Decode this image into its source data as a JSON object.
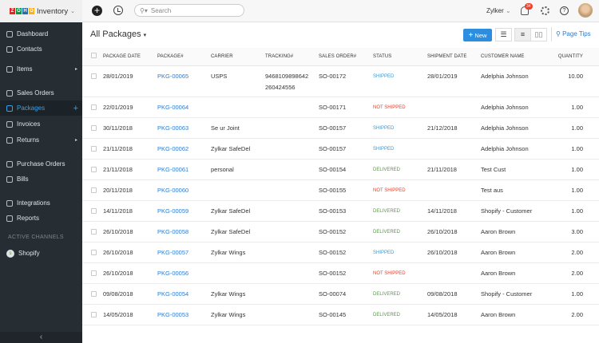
{
  "app": {
    "logo_letters": [
      "Z",
      "O",
      "H",
      "O"
    ],
    "name": "Inventory",
    "search_placeholder": "Search",
    "org": "Zylker",
    "notification_count": "34"
  },
  "sidebar": {
    "items": [
      {
        "label": "Dashboard",
        "icon": "home-icon"
      },
      {
        "label": "Contacts",
        "icon": "user-icon"
      },
      {
        "label": "Items",
        "icon": "basket-icon",
        "arrow": true
      },
      {
        "label": "Sales Orders",
        "icon": "cart-icon"
      },
      {
        "label": "Packages",
        "icon": "package-icon",
        "active": true
      },
      {
        "label": "Invoices",
        "icon": "invoice-icon"
      },
      {
        "label": "Returns",
        "icon": "returns-icon",
        "arrow": true
      },
      {
        "label": "Purchase Orders",
        "icon": "bag-icon"
      },
      {
        "label": "Bills",
        "icon": "bill-icon"
      },
      {
        "label": "Integrations",
        "icon": "integrations-icon"
      },
      {
        "label": "Reports",
        "icon": "reports-icon"
      }
    ],
    "channels_heading": "ACTIVE CHANNELS",
    "channel": "Shopify"
  },
  "main": {
    "title": "All Packages",
    "new_label": "New",
    "page_tips": "Page Tips"
  },
  "table": {
    "headers": [
      "PACKAGE DATE",
      "PACKAGE#",
      "CARRIER",
      "TRACKING#",
      "SALES ORDER#",
      "STATUS",
      "SHIPMENT DATE",
      "CUSTOMER NAME",
      "QUANTITY"
    ],
    "rows": [
      [
        "28/01/2019",
        "PKG-00065",
        "USPS",
        "9468109898642 260424556",
        "SO-00172",
        "SHIPPED",
        "28/01/2019",
        "Adelphia Johnson",
        "10.00"
      ],
      [
        "22/01/2019",
        "PKG-00064",
        "",
        "",
        "SO-00171",
        "NOT SHIPPED",
        "",
        "Adelphia Johnson",
        "1.00"
      ],
      [
        "30/11/2018",
        "PKG-00063",
        "Se ur Joint",
        "",
        "SO-00157",
        "SHIPPED",
        "21/12/2018",
        "Adelphia Johnson",
        "1.00"
      ],
      [
        "21/11/2018",
        "PKG-00062",
        "Zylkar SafeDel",
        "",
        "SO-00157",
        "SHIPPED",
        "",
        "Adelphia Johnson",
        "1.00"
      ],
      [
        "21/11/2018",
        "PKG-00061",
        "personal",
        "",
        "SO-00154",
        "DELIVERED",
        "21/11/2018",
        "Test Cust",
        "1.00"
      ],
      [
        "20/11/2018",
        "PKG-00060",
        "",
        "",
        "SO-00155",
        "NOT SHIPPED",
        "",
        "Test aus",
        "1.00"
      ],
      [
        "14/11/2018",
        "PKG-00059",
        "Zylkar SafeDel",
        "",
        "SO-00153",
        "DELIVERED",
        "14/11/2018",
        "Shopify - Customer",
        "1.00"
      ],
      [
        "26/10/2018",
        "PKG-00058",
        "Zylkar SafeDel",
        "",
        "SO-00152",
        "DELIVERED",
        "26/10/2018",
        "Aaron Brown",
        "3.00"
      ],
      [
        "26/10/2018",
        "PKG-00057",
        "Zylkar Wings",
        "",
        "SO-00152",
        "SHIPPED",
        "26/10/2018",
        "Aaron Brown",
        "2.00"
      ],
      [
        "26/10/2018",
        "PKG-00056",
        "",
        "",
        "SO-00152",
        "NOT SHIPPED",
        "",
        "Aaron Brown",
        "2.00"
      ],
      [
        "09/08/2018",
        "PKG-00054",
        "Zylkar Wings",
        "",
        "SO-00074",
        "DELIVERED",
        "09/08/2018",
        "Shopify - Customer",
        "1.00"
      ],
      [
        "14/05/2018",
        "PKG-00053",
        "Zylkar Wings",
        "",
        "SO-00145",
        "DELIVERED",
        "14/05/2018",
        "Aaron Brown",
        "2.00"
      ]
    ]
  },
  "colors": {
    "SHIPPED": "#2d9be0",
    "NOT SHIPPED": "#e8432e",
    "DELIVERED": "#4aa630",
    "logo": [
      "#e42527",
      "#089949",
      "#226db4",
      "#f9b21d"
    ]
  }
}
